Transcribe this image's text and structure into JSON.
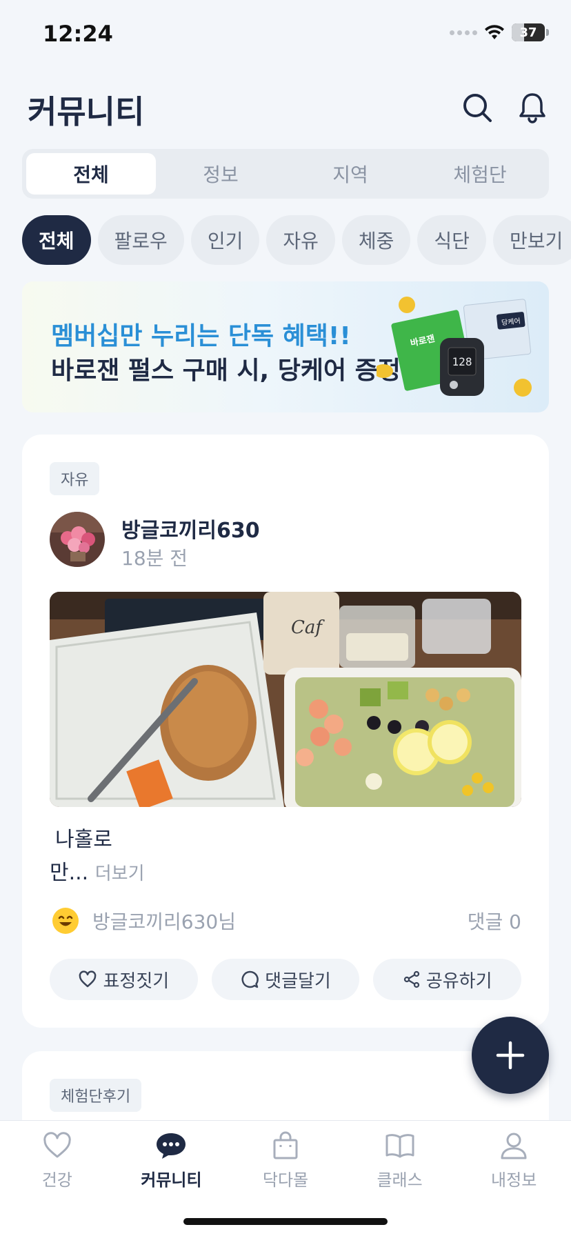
{
  "status": {
    "time": "12:24",
    "battery": "37",
    "battery_level": 0.37
  },
  "header": {
    "title": "커뮤니티"
  },
  "segments": [
    {
      "label": "전체",
      "active": true
    },
    {
      "label": "정보"
    },
    {
      "label": "지역"
    },
    {
      "label": "체험단"
    }
  ],
  "chips": [
    {
      "label": "전체",
      "active": true
    },
    {
      "label": "팔로우"
    },
    {
      "label": "인기"
    },
    {
      "label": "자유"
    },
    {
      "label": "체중"
    },
    {
      "label": "식단"
    },
    {
      "label": "만보기"
    }
  ],
  "banner": {
    "line1": "멤버십만 누리는 단독 혜택!!",
    "line2": "바로잰 펄스 구매 시, 당케어 증정",
    "art_box_green": "바로잰",
    "art_box_blue": "당케어"
  },
  "post": {
    "tag": "자유",
    "author": "방글코끼리630",
    "time": "18분 전",
    "body_line1": "나홀로",
    "body_line2": "만...",
    "more_label": "더보기",
    "reactor": "방글코끼리630님",
    "comment_count": "댓글 0",
    "actions": {
      "react": "표정짓기",
      "comment": "댓글달기",
      "share": "공유하기"
    }
  },
  "post2": {
    "tag": "체험단후기"
  },
  "nav": {
    "items": [
      {
        "label": "건강",
        "icon": "heart-icon"
      },
      {
        "label": "커뮤니티",
        "icon": "chat-bubble-icon",
        "active": true
      },
      {
        "label": "닥다몰",
        "icon": "shopping-bag-icon"
      },
      {
        "label": "클래스",
        "icon": "open-book-icon"
      },
      {
        "label": "내정보",
        "icon": "person-icon"
      }
    ]
  },
  "colors": {
    "primary": "#1f2a44",
    "accent": "#2a8fd6",
    "background": "#f3f6fa"
  }
}
